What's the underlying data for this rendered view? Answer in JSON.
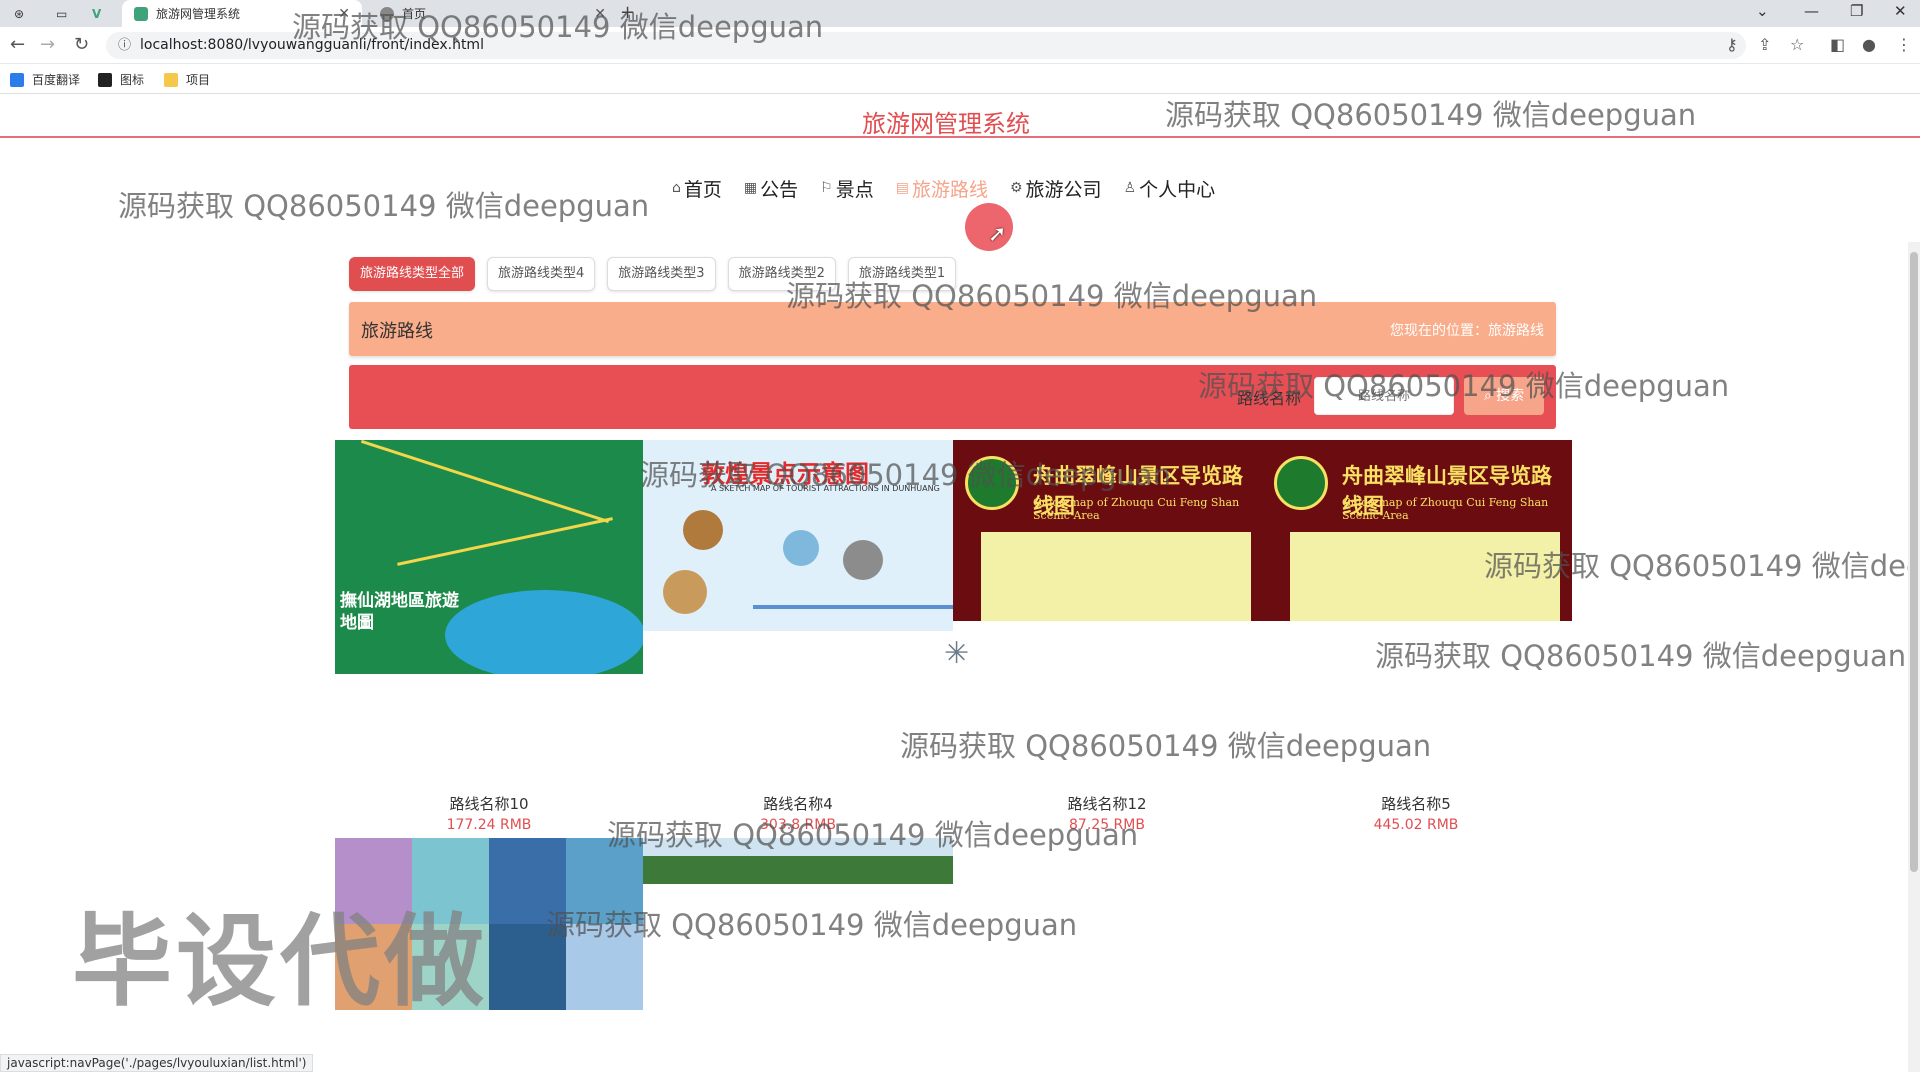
{
  "browser": {
    "active_tab_title": "旅游网管理系统",
    "second_tab_title": "首页",
    "url": "localhost:8080/lvyouwangguanli/front/index.html",
    "bookmarks": [
      "百度翻译",
      "图标",
      "项目"
    ]
  },
  "site": {
    "title": "旅游网管理系统"
  },
  "nav": {
    "items": [
      {
        "label": "首页",
        "icon": "home-icon",
        "active": false
      },
      {
        "label": "公告",
        "icon": "notice-icon",
        "active": false
      },
      {
        "label": "景点",
        "icon": "flag-icon",
        "active": false
      },
      {
        "label": "旅游路线",
        "icon": "route-icon",
        "active": true
      },
      {
        "label": "旅游公司",
        "icon": "company-icon",
        "active": false
      },
      {
        "label": "个人中心",
        "icon": "user-icon",
        "active": false
      }
    ]
  },
  "categories": [
    "旅游路线类型全部",
    "旅游路线类型4",
    "旅游路线类型3",
    "旅游路线类型2",
    "旅游路线类型1"
  ],
  "breadcrumb": {
    "title": "旅游路线",
    "position": "您现在的位置：旅游路线"
  },
  "search": {
    "label": "路线名称",
    "placeholder": "路线名称",
    "button": "搜索"
  },
  "images": {
    "map1_text": "撫仙湖地區旅遊地圖",
    "map2_title": "敦煌景点示意图",
    "map2_subtitle": "A SKETCH MAP OF TOURIST ATTRACTIONS IN DUNHUANG",
    "guide_title": "舟曲翠峰山景区导览路线图",
    "guide_subtitle": "Guide map of Zhouqu Cui Feng Shan Scenic Area"
  },
  "routes": [
    {
      "name": "路线名称10",
      "price": "177.24 RMB"
    },
    {
      "name": "路线名称4",
      "price": "303.8 RMB"
    },
    {
      "name": "路线名称12",
      "price": "87.25 RMB"
    },
    {
      "name": "路线名称5",
      "price": "445.02 RMB"
    }
  ],
  "watermark": {
    "text": "源码获取 QQ86050149 微信deepguan",
    "text_cut": "源码获取 QQ86050149 微信dee",
    "big": "毕设代做"
  },
  "status_bar": "javascript:navPage('./pages/lvyouluxian/list.html')",
  "colors": {
    "accent_red": "#e14e50",
    "search_bar": "#e74f55",
    "breadcrumb_bar": "#f9ad8a",
    "active_nav": "#f6a48a"
  }
}
